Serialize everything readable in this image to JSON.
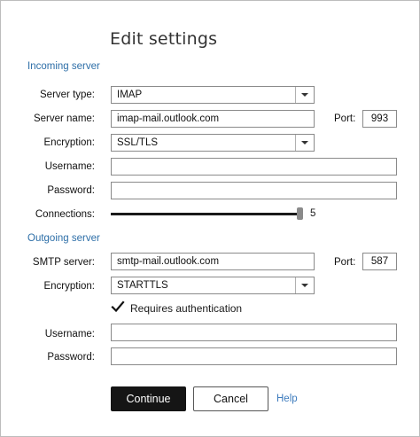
{
  "title": "Edit settings",
  "incoming": {
    "section_label": "Incoming server",
    "server_type_label": "Server type:",
    "server_type_value": "IMAP",
    "server_name_label": "Server name:",
    "server_name_value": "imap-mail.outlook.com",
    "port_label": "Port:",
    "port_value": "993",
    "encryption_label": "Encryption:",
    "encryption_value": "SSL/TLS",
    "username_label": "Username:",
    "username_value": "",
    "password_label": "Password:",
    "password_value": "",
    "connections_label": "Connections:",
    "connections_value": "5"
  },
  "outgoing": {
    "section_label": "Outgoing server",
    "smtp_label": "SMTP server:",
    "smtp_value": "smtp-mail.outlook.com",
    "port_label": "Port:",
    "port_value": "587",
    "encryption_label": "Encryption:",
    "encryption_value": "STARTTLS",
    "requires_auth_label": "Requires authentication",
    "requires_auth_checked": true,
    "username_label": "Username:",
    "username_value": "",
    "password_label": "Password:",
    "password_value": ""
  },
  "buttons": {
    "continue_label": "Continue",
    "cancel_label": "Cancel",
    "help_label": "Help"
  },
  "colors": {
    "section": "#2e6fa8",
    "link": "#3d7bbd",
    "primary_button": "#151515"
  }
}
